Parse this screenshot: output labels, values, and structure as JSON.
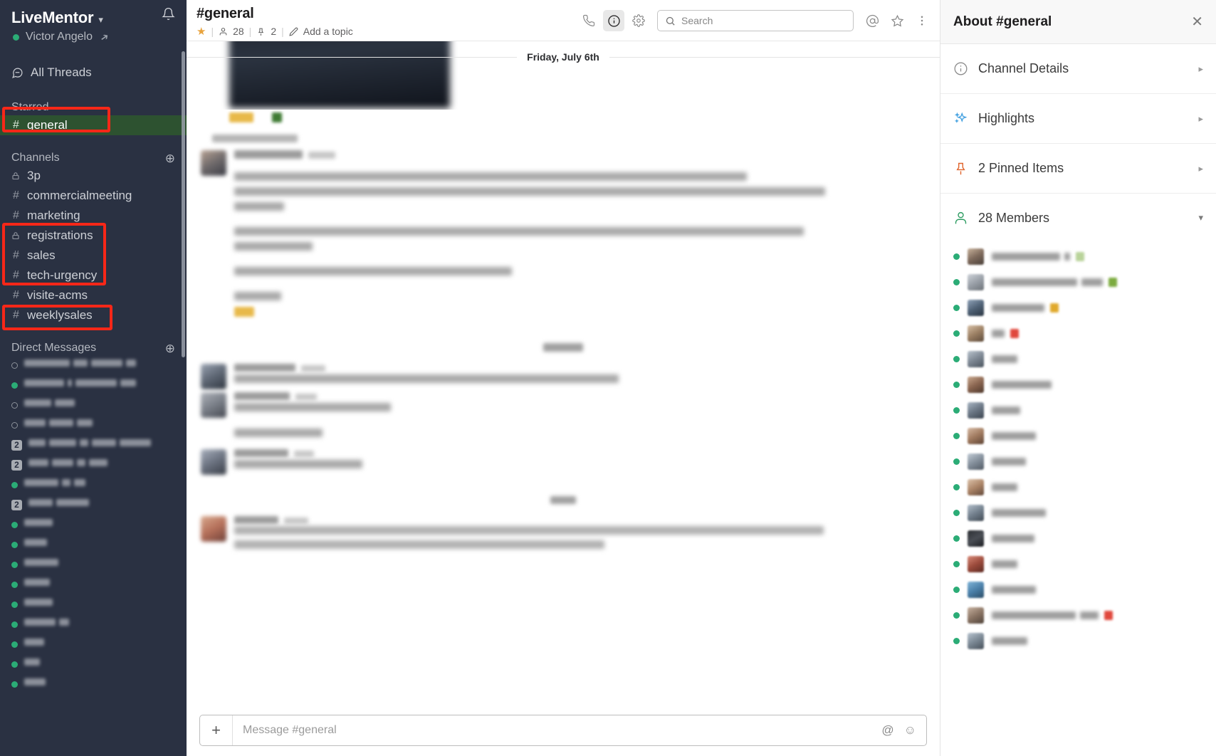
{
  "sidebar": {
    "workspace_name": "LiveMentor",
    "user_name": "Victor Angelo",
    "all_threads_label": "All Threads",
    "starred_label": "Starred",
    "starred_items": [
      {
        "name": "general",
        "prefix": "#",
        "selected": true,
        "annotated": true
      }
    ],
    "channels_label": "Channels",
    "channels": [
      {
        "name": "3p",
        "prefix": "lock"
      },
      {
        "name": "commercialmeeting",
        "prefix": "#"
      },
      {
        "name": "marketing",
        "prefix": "#"
      },
      {
        "name": "registrations",
        "prefix": "lock"
      },
      {
        "name": "sales",
        "prefix": "#"
      },
      {
        "name": "tech-urgency",
        "prefix": "#"
      },
      {
        "name": "visite-acms",
        "prefix": "#"
      },
      {
        "name": "weeklysales",
        "prefix": "#"
      }
    ],
    "dm_label": "Direct Messages",
    "dms": [
      {
        "presence": "off",
        "badge": "",
        "blocks": [
          64,
          20,
          44,
          14
        ]
      },
      {
        "presence": "on",
        "badge": "",
        "blocks": [
          56,
          6,
          58,
          22
        ]
      },
      {
        "presence": "off",
        "badge": "",
        "blocks": [
          38,
          28
        ]
      },
      {
        "presence": "off",
        "badge": "",
        "blocks": [
          30,
          34,
          22
        ]
      },
      {
        "presence": "",
        "badge": "2",
        "blocks": [
          24,
          38,
          12,
          34,
          44
        ]
      },
      {
        "presence": "",
        "badge": "2",
        "blocks": [
          28,
          30,
          12,
          26
        ]
      },
      {
        "presence": "on",
        "badge": "",
        "blocks": [
          48,
          12,
          16
        ]
      },
      {
        "presence": "",
        "badge": "2",
        "blocks": [
          34,
          46
        ]
      },
      {
        "presence": "on",
        "badge": "",
        "blocks": [
          40
        ]
      },
      {
        "presence": "on",
        "badge": "",
        "blocks": [
          32
        ]
      },
      {
        "presence": "on",
        "badge": "",
        "blocks": [
          48
        ]
      },
      {
        "presence": "on",
        "badge": "",
        "blocks": [
          36
        ]
      },
      {
        "presence": "on",
        "badge": "",
        "blocks": [
          40
        ]
      },
      {
        "presence": "on",
        "badge": "",
        "blocks": [
          44,
          14
        ]
      },
      {
        "presence": "on",
        "badge": "",
        "blocks": [
          28
        ]
      },
      {
        "presence": "on",
        "badge": "",
        "blocks": [
          22
        ]
      },
      {
        "presence": "on",
        "badge": "",
        "blocks": [
          30
        ]
      }
    ]
  },
  "header": {
    "channel_title": "#general",
    "member_count": "28",
    "pin_count": "2",
    "topic_placeholder": "Add a topic",
    "search_placeholder": "Search"
  },
  "messages": {
    "date_divider": "Friday, July 6th",
    "composer_placeholder": "Message #general"
  },
  "right_panel": {
    "title": "About #general",
    "rows": [
      {
        "label": "Channel Details",
        "icon": "info-icon"
      },
      {
        "label": "Highlights",
        "icon": "sparkle-icon"
      },
      {
        "label": "2 Pinned Items",
        "icon": "pin-icon"
      }
    ],
    "members_label": "28 Members",
    "members": [
      {
        "blocks": [
          96,
          8
        ],
        "badge": "#b9d39a"
      },
      {
        "blocks": [
          120,
          30
        ],
        "badge": "#7cab3f"
      },
      {
        "blocks": [
          74
        ],
        "badge": "#e0a92c"
      },
      {
        "blocks": [
          18
        ],
        "badge": "#e0473c"
      },
      {
        "blocks": [
          36
        ],
        "badge": ""
      },
      {
        "blocks": [
          84
        ],
        "badge": ""
      },
      {
        "blocks": [
          40
        ],
        "badge": ""
      },
      {
        "blocks": [
          62
        ],
        "badge": ""
      },
      {
        "blocks": [
          48
        ],
        "badge": ""
      },
      {
        "blocks": [
          36
        ],
        "badge": ""
      },
      {
        "blocks": [
          76
        ],
        "badge": ""
      },
      {
        "blocks": [
          60
        ],
        "badge": ""
      },
      {
        "blocks": [
          36
        ],
        "badge": ""
      },
      {
        "blocks": [
          62
        ],
        "badge": ""
      },
      {
        "blocks": [
          118,
          26
        ],
        "badge": "#e0473c"
      },
      {
        "blocks": [
          50
        ],
        "badge": ""
      }
    ]
  },
  "colors": {
    "sidebar_bg": "#2a3142",
    "selected_channel": "#2d5230",
    "annotation_red": "#f72718",
    "presence_green": "#2bac76",
    "star_gold": "#e8a33d"
  }
}
